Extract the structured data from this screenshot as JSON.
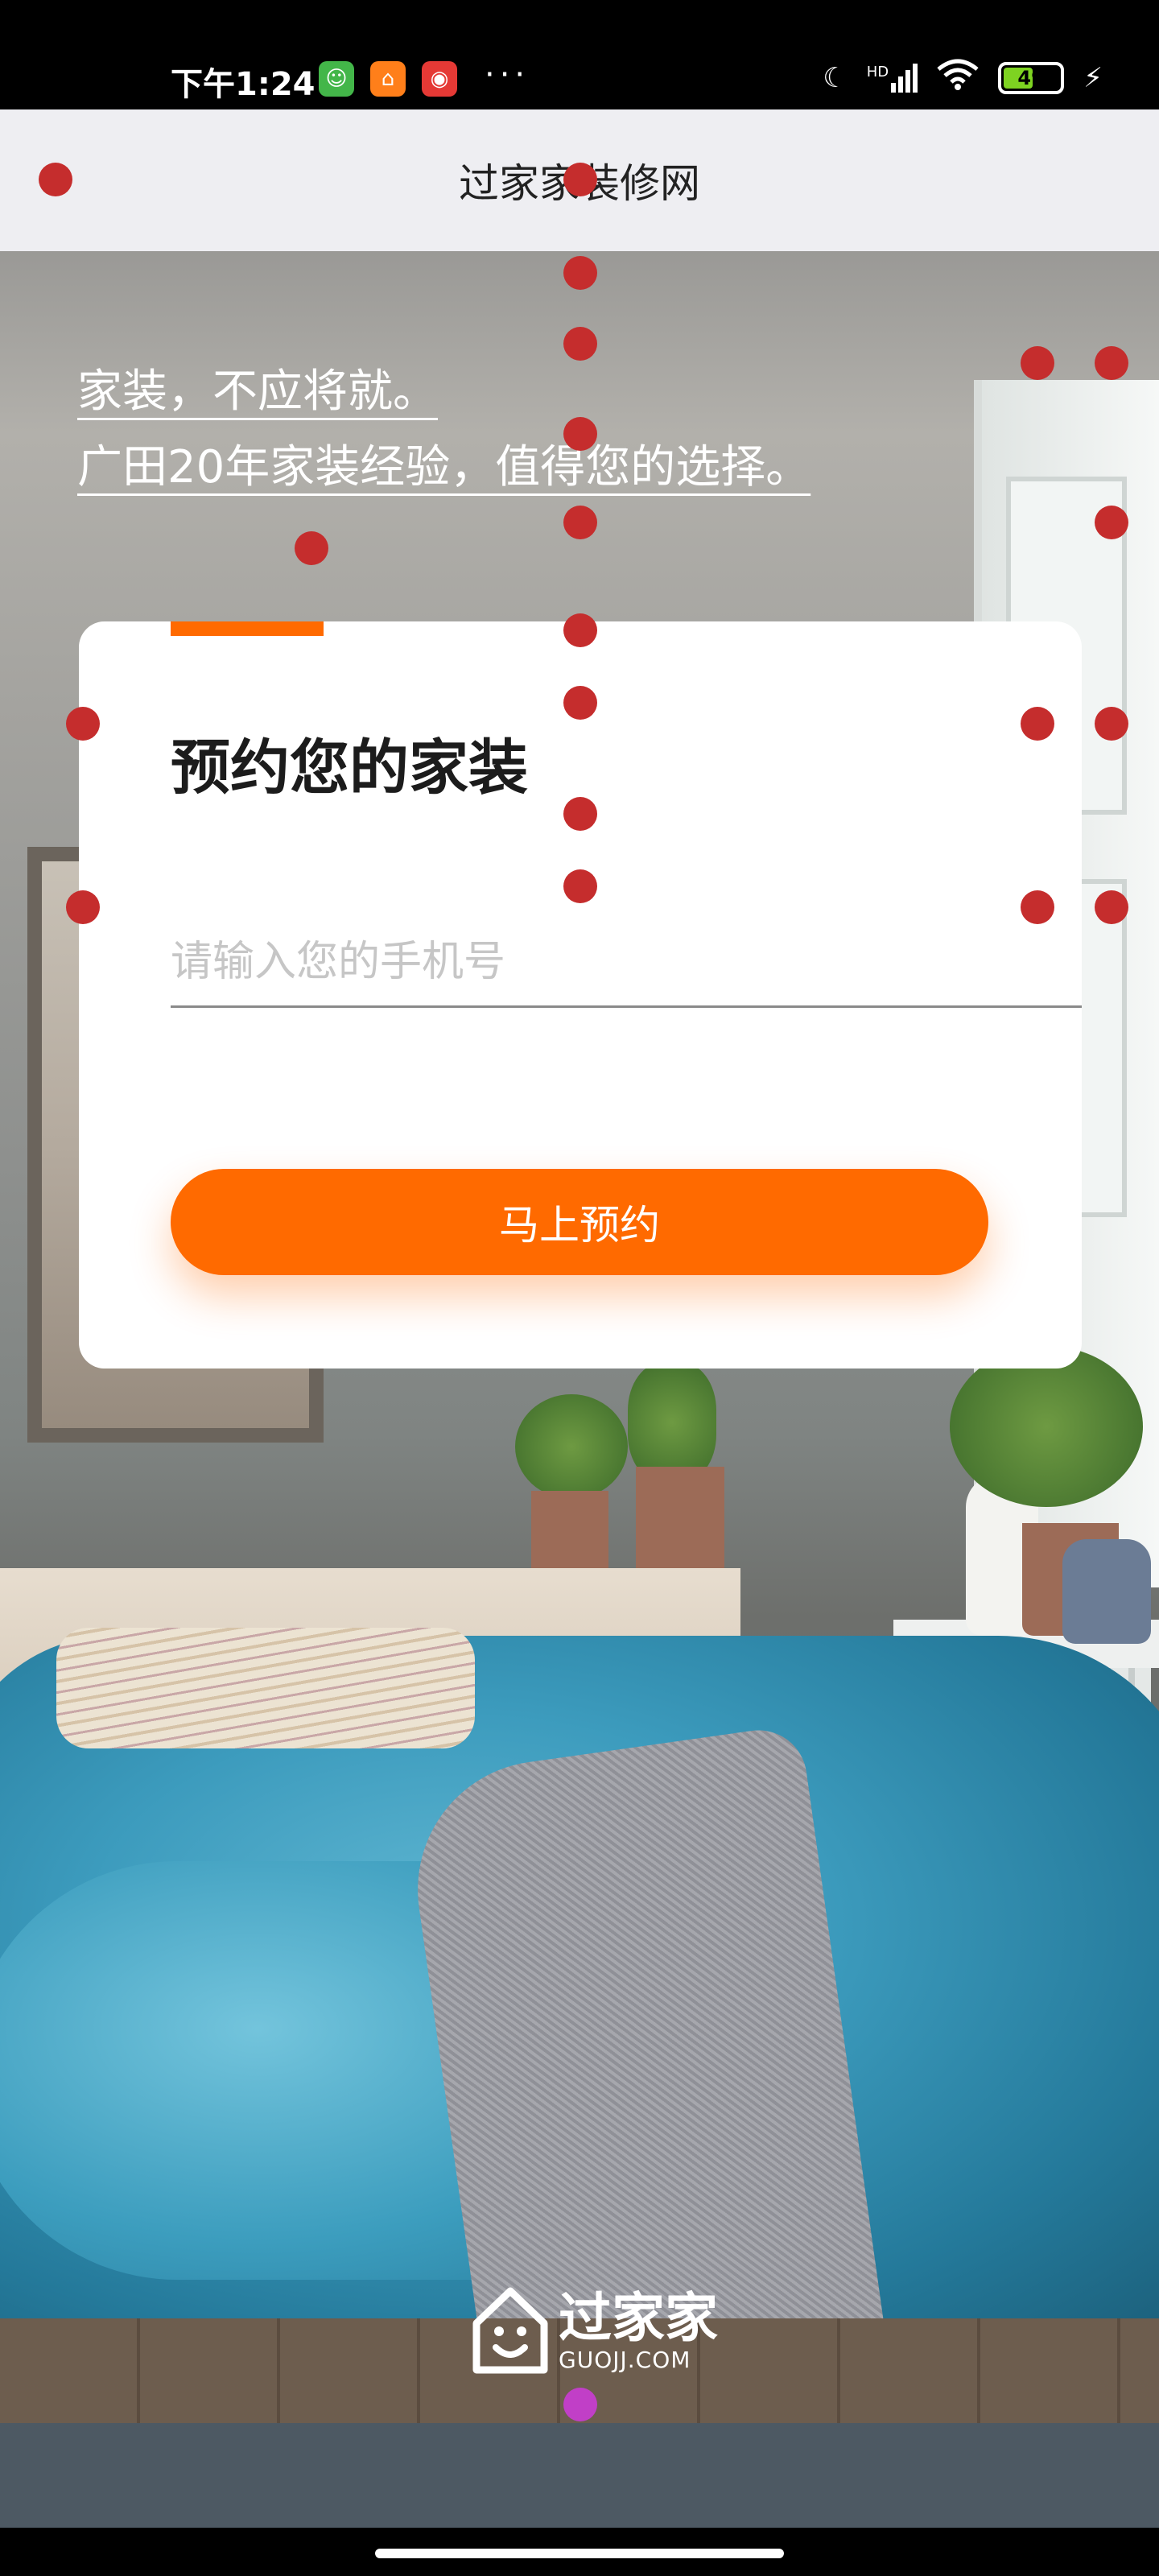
{
  "status_bar": {
    "time": "下午1:24",
    "apps": [
      {
        "icon": "android-app-icon",
        "color": "#43b649",
        "glyph": "☺"
      },
      {
        "icon": "home-app-icon",
        "color": "#ff7f1a",
        "glyph": "⌂"
      },
      {
        "icon": "red-app-icon",
        "color": "#e53935",
        "glyph": "◉"
      }
    ],
    "more": "···",
    "network": "HD",
    "battery": "49",
    "battery_level": 0.49,
    "icons": [
      "moon-icon",
      "signal-icon",
      "wifi-icon",
      "battery-icon",
      "charging-icon"
    ]
  },
  "header": {
    "title": "过家家装修网"
  },
  "hero": {
    "line1": "家装，不应将就。",
    "line2": "广田20年家装经验，值得您的选择。"
  },
  "form": {
    "title": "预约您的家装",
    "phone_placeholder": "请输入您的手机号",
    "phone_value": "",
    "submit_label": "马上预约"
  },
  "logo": {
    "cn": "过家家",
    "en": "GUOJJ.COM"
  },
  "colors": {
    "accent": "#ff6a00",
    "overlay_dot": "#c52d2d",
    "overlay_dot_highlight": "#c13fc7"
  }
}
